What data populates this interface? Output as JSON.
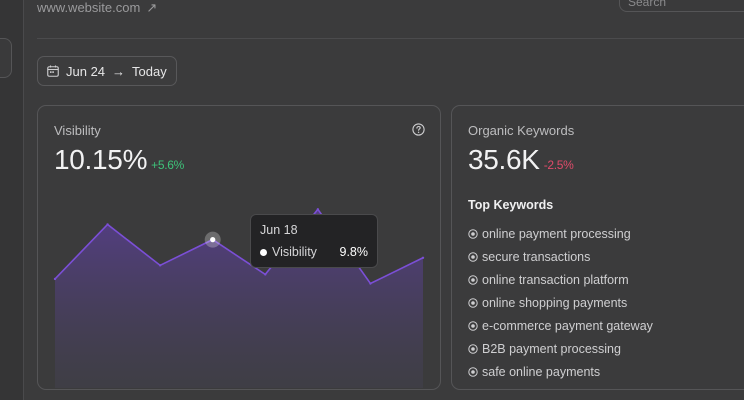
{
  "header": {
    "site_url": "www.website.com",
    "site_link_arrow": "↗",
    "search_placeholder": "Search"
  },
  "date_range": {
    "from": "Jun 24",
    "arrow": "→",
    "to": "Today"
  },
  "visibility_card": {
    "title": "Visibility",
    "value": "10.15%",
    "delta": "+5.6%",
    "delta_color": "#3ec37a",
    "help_icon": "question-circle-icon",
    "tooltip": {
      "date": "Jun 18",
      "label": "Visibility",
      "value": "9.8%"
    }
  },
  "keywords_card": {
    "title": "Organic Keywords",
    "value": "35.6K",
    "delta": "-2.5%",
    "delta_color": "#e04b6a",
    "subtitle": "Top Keywords",
    "keywords": [
      "online payment processing",
      "secure transactions",
      "online transaction platform",
      "online shopping payments",
      "e-commerce payment gateway",
      "B2B payment processing",
      "safe online payments"
    ]
  },
  "chart_data": {
    "type": "area",
    "series": [
      {
        "values": [
          7.2,
          10.8,
          8.1,
          9.8,
          7.5,
          11.8,
          6.9,
          8.6
        ]
      }
    ],
    "ylim": [
      0,
      14
    ],
    "highlight_index": 3,
    "color": "#7b4fd6"
  }
}
